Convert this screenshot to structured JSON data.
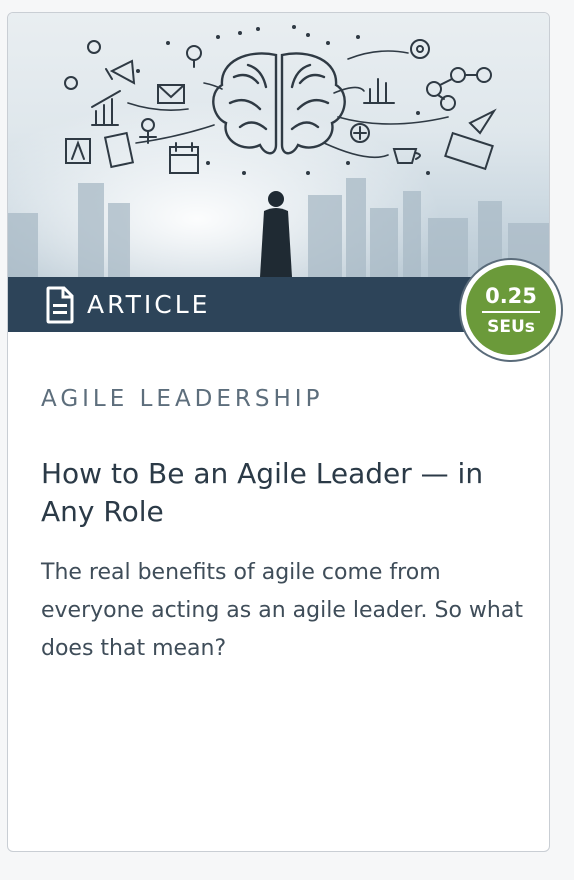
{
  "card": {
    "hero_image": {
      "description_icon": "brain-sketch-icon",
      "colors": {
        "sky": "#dfe7ec",
        "skyline": "#b9c9d4",
        "sketch": "#2f3a44"
      }
    },
    "content_type": {
      "label": "ARTICLE",
      "icon": "document-icon",
      "bar_color": "#2d4459"
    },
    "credit_badge": {
      "value": "0.25",
      "unit": "SEUs",
      "color": "#6b9a3a"
    },
    "category": "AGILE LEADERSHIP",
    "title": "How to Be an Agile Leader — in Any Role",
    "summary": "The real benefits of agile come from everyone acting as an agile leader. So what does that mean?"
  }
}
